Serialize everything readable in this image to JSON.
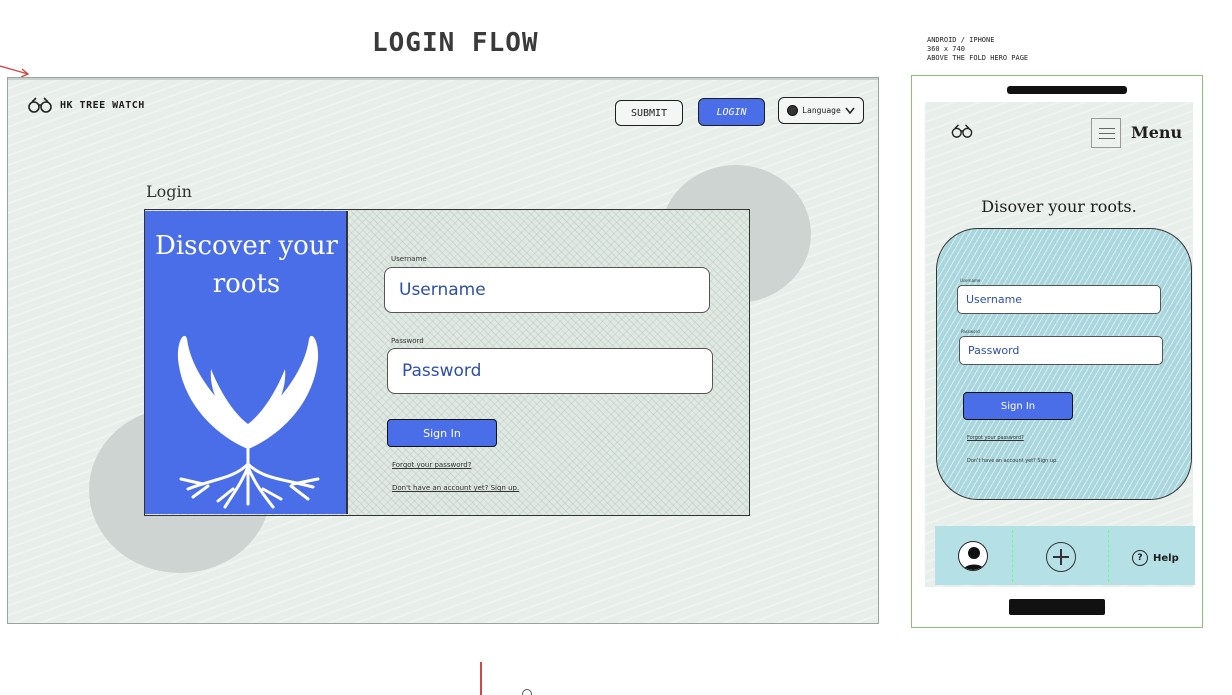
{
  "canvas": {
    "flow_title": "LOGIN FLOW",
    "device_note": "ANDROID / IPHONE\n360 x 740\nABOVE THE FOLD HERO PAGE"
  },
  "desktop": {
    "brand": "HK TREE WATCH",
    "nav": {
      "submit_label": "SUBMIT",
      "login_label": "LOGIN",
      "language_label": "Language"
    },
    "login_heading": "Login",
    "hero_text": "Discover your roots",
    "form": {
      "username_label": "Username",
      "username_placeholder": "Username",
      "password_label": "Password",
      "password_placeholder": "Password",
      "signin_label": "Sign In",
      "forgot_link": "Forgot your password?",
      "signup_link": "Don't have an account yet? Sign up."
    }
  },
  "mobile": {
    "menu_label": "Menu",
    "heading": "Disover your roots.",
    "form": {
      "username_label": "Username",
      "username_placeholder": "Username",
      "password_label": "Password",
      "password_placeholder": "Password",
      "signin_label": "Sign In",
      "forgot_link": "Forgot your password?",
      "signup_link": "Don't have an account yet? Sign up."
    },
    "bottom_nav": {
      "help_label": "Help"
    }
  },
  "colors": {
    "primary_blue": "#4a6ee8",
    "frame_bg": "#e8eeea",
    "mobile_card": "#a9d7dd",
    "mobile_nav": "#b4e0e6",
    "phone_border": "#8cc07a"
  },
  "icons": [
    "binoculars-icon",
    "globe-icon",
    "chevron-down-icon",
    "hamburger-menu-icon",
    "user-avatar-icon",
    "plus-icon",
    "help-icon",
    "tree-roots-hands-icon"
  ]
}
